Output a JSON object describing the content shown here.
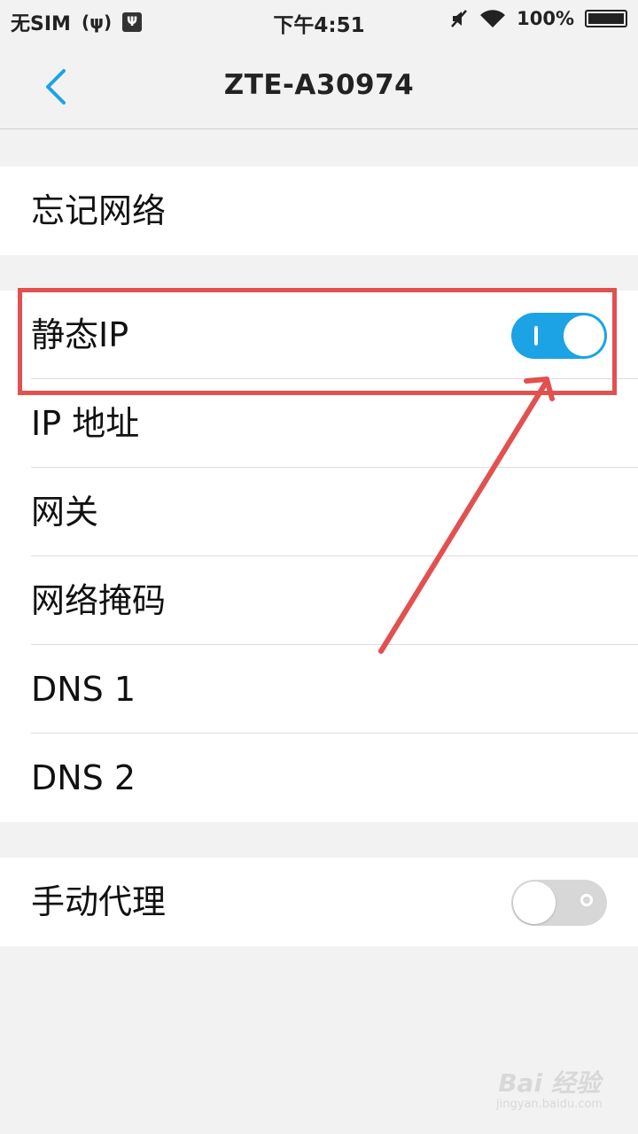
{
  "status_bar": {
    "carrier": "无SIM",
    "time": "下午4:51",
    "battery": "100%"
  },
  "app_bar": {
    "title": "ZTE-A30974"
  },
  "forget_group": {
    "label": "忘记网络"
  },
  "ip_group": {
    "static_ip": {
      "label": "静态IP",
      "enabled": true
    },
    "ip_address": "IP 地址",
    "gateway": "网关",
    "netmask": "网络掩码",
    "dns1": "DNS 1",
    "dns2": "DNS 2"
  },
  "proxy_group": {
    "manual_proxy": {
      "label": "手动代理",
      "enabled": false
    }
  },
  "colors": {
    "accent": "#1ba3e5",
    "annotation": "#e2504f",
    "background": "#f2f2f2"
  },
  "watermark": {
    "brand": "Bai 经验",
    "url": "jingyan.baidu.com"
  }
}
